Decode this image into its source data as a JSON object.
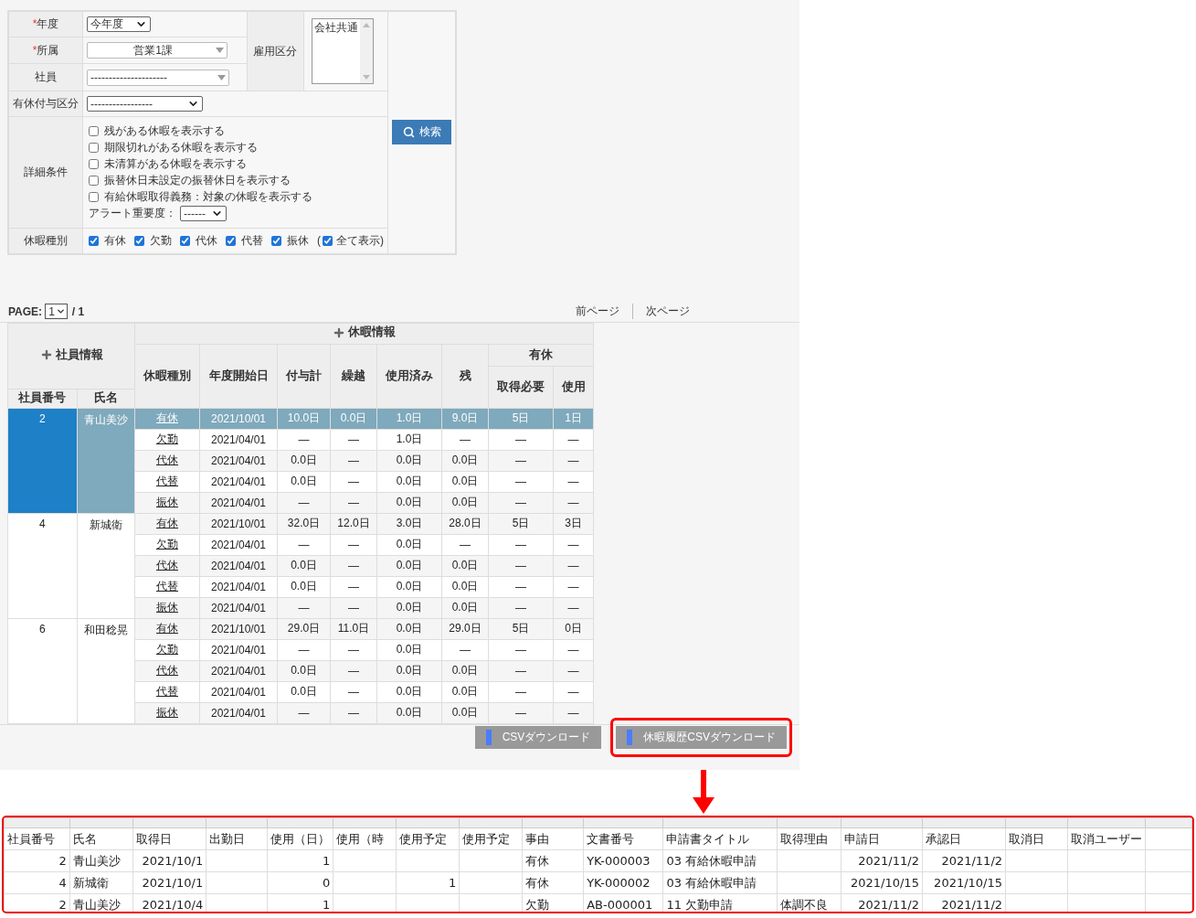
{
  "search_form": {
    "year": {
      "label": "年度",
      "required_mark": "*",
      "value": "今年度"
    },
    "department": {
      "label": "所属",
      "required_mark": "*",
      "value": "営業1課"
    },
    "employee": {
      "label": "社員",
      "value": "---------------------"
    },
    "employment_type": {
      "label": "雇用区分",
      "options": [
        "会社共通"
      ]
    },
    "grant_type": {
      "label": "有休付与区分",
      "value": "-----------------"
    },
    "details": {
      "label": "詳細条件",
      "checkboxes": [
        {
          "label": "残がある休暇を表示する",
          "checked": false
        },
        {
          "label": "期限切れがある休暇を表示する",
          "checked": false
        },
        {
          "label": "未清算がある休暇を表示する",
          "checked": false
        },
        {
          "label": "振替休日未設定の振替休日を表示する",
          "checked": false
        },
        {
          "label": "有給休暇取得義務：対象の休暇を表示する",
          "checked": false
        }
      ],
      "alert_label": "アラート重要度：",
      "alert_value": "------"
    },
    "leave_types": {
      "label": "休暇種別",
      "checkboxes": [
        {
          "label": "有休",
          "checked": true
        },
        {
          "label": "欠勤",
          "checked": true
        },
        {
          "label": "代休",
          "checked": true
        },
        {
          "label": "代替",
          "checked": true
        },
        {
          "label": "振休",
          "checked": true
        }
      ],
      "show_all": {
        "prefix": "(",
        "label": "全て表示)",
        "checked": true
      }
    },
    "search_button": "検索"
  },
  "pager": {
    "label": "PAGE:",
    "page": "1",
    "total": "/ 1",
    "prev": "前ページ",
    "next": "次ページ"
  },
  "table": {
    "group_headers": [
      "社員情報",
      "休暇情報"
    ],
    "paid_header": "有休",
    "columns": [
      "社員番号",
      "氏名",
      "休暇種別",
      "年度開始日",
      "付与計",
      "繰越",
      "使用済み",
      "残",
      "取得必要",
      "使用"
    ],
    "employees": [
      {
        "number": "2",
        "name": "青山美沙",
        "selected": true,
        "leaves": [
          {
            "type": "有休",
            "start": "2021/10/01",
            "granted": "10.0日",
            "carry": "0.0日",
            "used": "1.0日",
            "remaining": "9.0日",
            "required": "5日",
            "paid_used": "1日",
            "selected": true
          },
          {
            "type": "欠勤",
            "start": "2021/04/01",
            "granted": "—",
            "carry": "—",
            "used": "1.0日",
            "remaining": "—",
            "required": "—",
            "paid_used": "—",
            "selected": false
          },
          {
            "type": "代休",
            "start": "2021/04/01",
            "granted": "0.0日",
            "carry": "—",
            "used": "0.0日",
            "remaining": "0.0日",
            "required": "—",
            "paid_used": "—",
            "selected": false
          },
          {
            "type": "代替",
            "start": "2021/04/01",
            "granted": "0.0日",
            "carry": "—",
            "used": "0.0日",
            "remaining": "0.0日",
            "required": "—",
            "paid_used": "—",
            "selected": false
          },
          {
            "type": "振休",
            "start": "2021/04/01",
            "granted": "—",
            "carry": "—",
            "used": "0.0日",
            "remaining": "0.0日",
            "required": "—",
            "paid_used": "—",
            "selected": false
          }
        ]
      },
      {
        "number": "4",
        "name": "新城衛",
        "selected": false,
        "leaves": [
          {
            "type": "有休",
            "start": "2021/10/01",
            "granted": "32.0日",
            "carry": "12.0日",
            "used": "3.0日",
            "remaining": "28.0日",
            "required": "5日",
            "paid_used": "3日",
            "selected": false
          },
          {
            "type": "欠勤",
            "start": "2021/04/01",
            "granted": "—",
            "carry": "—",
            "used": "0.0日",
            "remaining": "—",
            "required": "—",
            "paid_used": "—",
            "selected": false
          },
          {
            "type": "代休",
            "start": "2021/04/01",
            "granted": "0.0日",
            "carry": "—",
            "used": "0.0日",
            "remaining": "0.0日",
            "required": "—",
            "paid_used": "—",
            "selected": false
          },
          {
            "type": "代替",
            "start": "2021/04/01",
            "granted": "0.0日",
            "carry": "—",
            "used": "0.0日",
            "remaining": "0.0日",
            "required": "—",
            "paid_used": "—",
            "selected": false
          },
          {
            "type": "振休",
            "start": "2021/04/01",
            "granted": "—",
            "carry": "—",
            "used": "0.0日",
            "remaining": "0.0日",
            "required": "—",
            "paid_used": "—",
            "selected": false
          }
        ]
      },
      {
        "number": "6",
        "name": "和田稔晃",
        "selected": false,
        "leaves": [
          {
            "type": "有休",
            "start": "2021/10/01",
            "granted": "29.0日",
            "carry": "11.0日",
            "used": "0.0日",
            "remaining": "29.0日",
            "required": "5日",
            "paid_used": "0日",
            "selected": false
          },
          {
            "type": "欠勤",
            "start": "2021/04/01",
            "granted": "—",
            "carry": "—",
            "used": "0.0日",
            "remaining": "—",
            "required": "—",
            "paid_used": "—",
            "selected": false
          },
          {
            "type": "代休",
            "start": "2021/04/01",
            "granted": "0.0日",
            "carry": "—",
            "used": "0.0日",
            "remaining": "0.0日",
            "required": "—",
            "paid_used": "—",
            "selected": false
          },
          {
            "type": "代替",
            "start": "2021/04/01",
            "granted": "0.0日",
            "carry": "—",
            "used": "0.0日",
            "remaining": "0.0日",
            "required": "—",
            "paid_used": "—",
            "selected": false
          },
          {
            "type": "振休",
            "start": "2021/04/01",
            "granted": "—",
            "carry": "—",
            "used": "0.0日",
            "remaining": "0.0日",
            "required": "—",
            "paid_used": "—",
            "selected": false
          }
        ]
      }
    ]
  },
  "buttons": [
    {
      "label": "CSVダウンロード",
      "highlighted": false
    },
    {
      "label": "休暇履歴CSVダウンロード",
      "highlighted": true
    }
  ],
  "spreadsheet": {
    "columns": [
      {
        "label": "社員番号",
        "kind": "number"
      },
      {
        "label": "氏名",
        "kind": "text"
      },
      {
        "label": "取得日",
        "kind": "number"
      },
      {
        "label": "出勤日"
      },
      {
        "label": "使用（日）",
        "kind": "number"
      },
      {
        "label": "使用（時"
      },
      {
        "label": "使用予定",
        "kind": "number"
      },
      {
        "label": "使用予定"
      },
      {
        "label": "事由",
        "kind": "text"
      },
      {
        "label": "文書番号",
        "kind": "text"
      },
      {
        "label": "申請書タイトル",
        "kind": "text"
      },
      {
        "label": "取得理由",
        "kind": "text"
      },
      {
        "label": "申請日",
        "kind": "number"
      },
      {
        "label": "承認日",
        "kind": "number"
      },
      {
        "label": "取消日"
      },
      {
        "label": "取消ユーザー"
      }
    ],
    "rows": [
      [
        "2",
        "青山美沙",
        "2021/10/1",
        null,
        "1",
        null,
        null,
        null,
        "有休",
        "YK-000003",
        "03 有給休暇申請",
        null,
        "2021/11/2",
        "2021/11/2",
        null,
        null
      ],
      [
        "4",
        "新城衛",
        "2021/10/1",
        null,
        "0",
        null,
        "1",
        null,
        "有休",
        "YK-000002",
        "03 有給休暇申請",
        null,
        "2021/10/15",
        "2021/10/15",
        null,
        null
      ],
      [
        "2",
        "青山美沙",
        "2021/10/4",
        null,
        "1",
        null,
        null,
        null,
        "欠勤",
        "AB-000001",
        "11 欠勤申請",
        "体調不良",
        "2021/11/2",
        "2021/11/2",
        null,
        null
      ]
    ]
  }
}
